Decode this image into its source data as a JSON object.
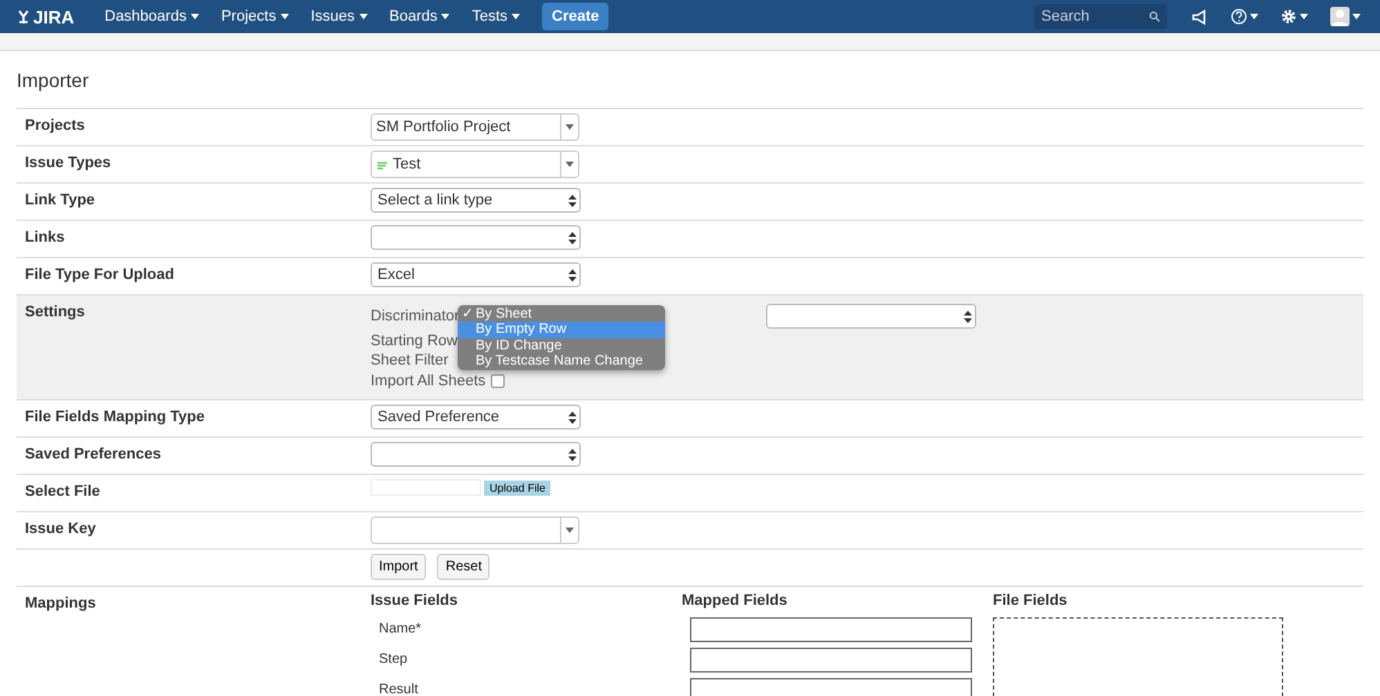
{
  "header": {
    "logo": "JIRA",
    "menus": [
      {
        "label": "Dashboards"
      },
      {
        "label": "Projects"
      },
      {
        "label": "Issues"
      },
      {
        "label": "Boards"
      },
      {
        "label": "Tests"
      }
    ],
    "create": "Create",
    "search": {
      "placeholder": "Search"
    }
  },
  "page_title": "Importer",
  "rows": [
    {
      "label": "Projects",
      "kind": "combo",
      "value": "SM Portfolio Project"
    },
    {
      "label": "Issue Types",
      "kind": "combo",
      "value": "Test",
      "icon": true
    },
    {
      "label": "Link Type",
      "kind": "select",
      "value": "Select a link type"
    },
    {
      "label": "Links",
      "kind": "select",
      "value": ""
    },
    {
      "label": "File Type For Upload",
      "kind": "select",
      "value": "Excel"
    },
    {
      "label": "Settings",
      "kind": "settings"
    },
    {
      "label": "File Fields Mapping Type",
      "kind": "select",
      "value": "Saved Preference"
    },
    {
      "label": "Saved Preferences",
      "kind": "select",
      "value": ""
    },
    {
      "label": "Select File",
      "kind": "file",
      "button": "Upload File"
    },
    {
      "label": "Issue Key",
      "kind": "combo",
      "value": ""
    },
    {
      "label": "",
      "kind": "buttons",
      "buttons": [
        "Import",
        "Reset"
      ]
    }
  ],
  "settings": {
    "check_mark": "✓",
    "discriminator_label": "Discriminator",
    "starting_row_label": "Starting Row",
    "sheet_filter_label": "Sheet Filter",
    "import_all_label": "Import All Sheets",
    "import_all_checked": false,
    "options": [
      {
        "label": "By Sheet",
        "checked": true,
        "highlighted": false
      },
      {
        "label": "By Empty Row",
        "checked": false,
        "highlighted": true
      },
      {
        "label": "By ID Change",
        "checked": false,
        "highlighted": false
      },
      {
        "label": "By Testcase Name Change",
        "checked": false,
        "highlighted": false
      }
    ]
  },
  "mappings": {
    "label": "Mappings",
    "issue_fields_heading": "Issue Fields",
    "mapped_fields_heading": "Mapped Fields",
    "file_fields_heading": "File Fields",
    "fields": [
      {
        "name": "Name*"
      },
      {
        "name": "Step"
      },
      {
        "name": "Result"
      }
    ]
  }
}
